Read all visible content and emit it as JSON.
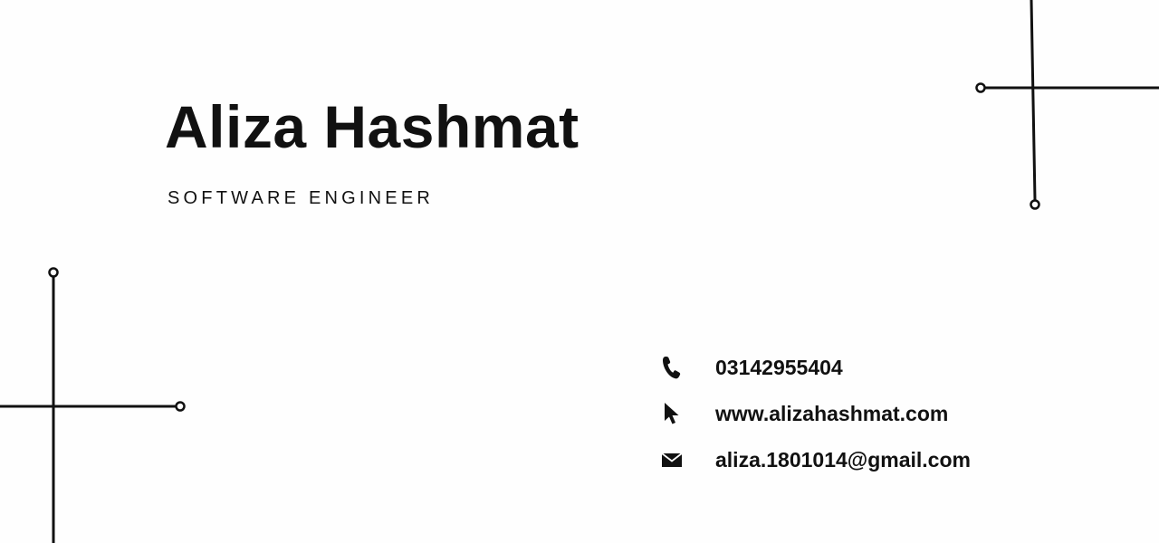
{
  "card": {
    "name": "Aliza Hashmat",
    "title": "SOFTWARE ENGINEER",
    "contacts": [
      {
        "icon": "phone-icon",
        "value": "03142955404"
      },
      {
        "icon": "cursor-pointer-icon",
        "value": "www.alizahashmat.com"
      },
      {
        "icon": "envelope-icon",
        "value": "aliza.1801014@gmail.com"
      }
    ]
  },
  "colors": {
    "background": "#fefefe",
    "text": "#111111",
    "lines": "#111111"
  }
}
